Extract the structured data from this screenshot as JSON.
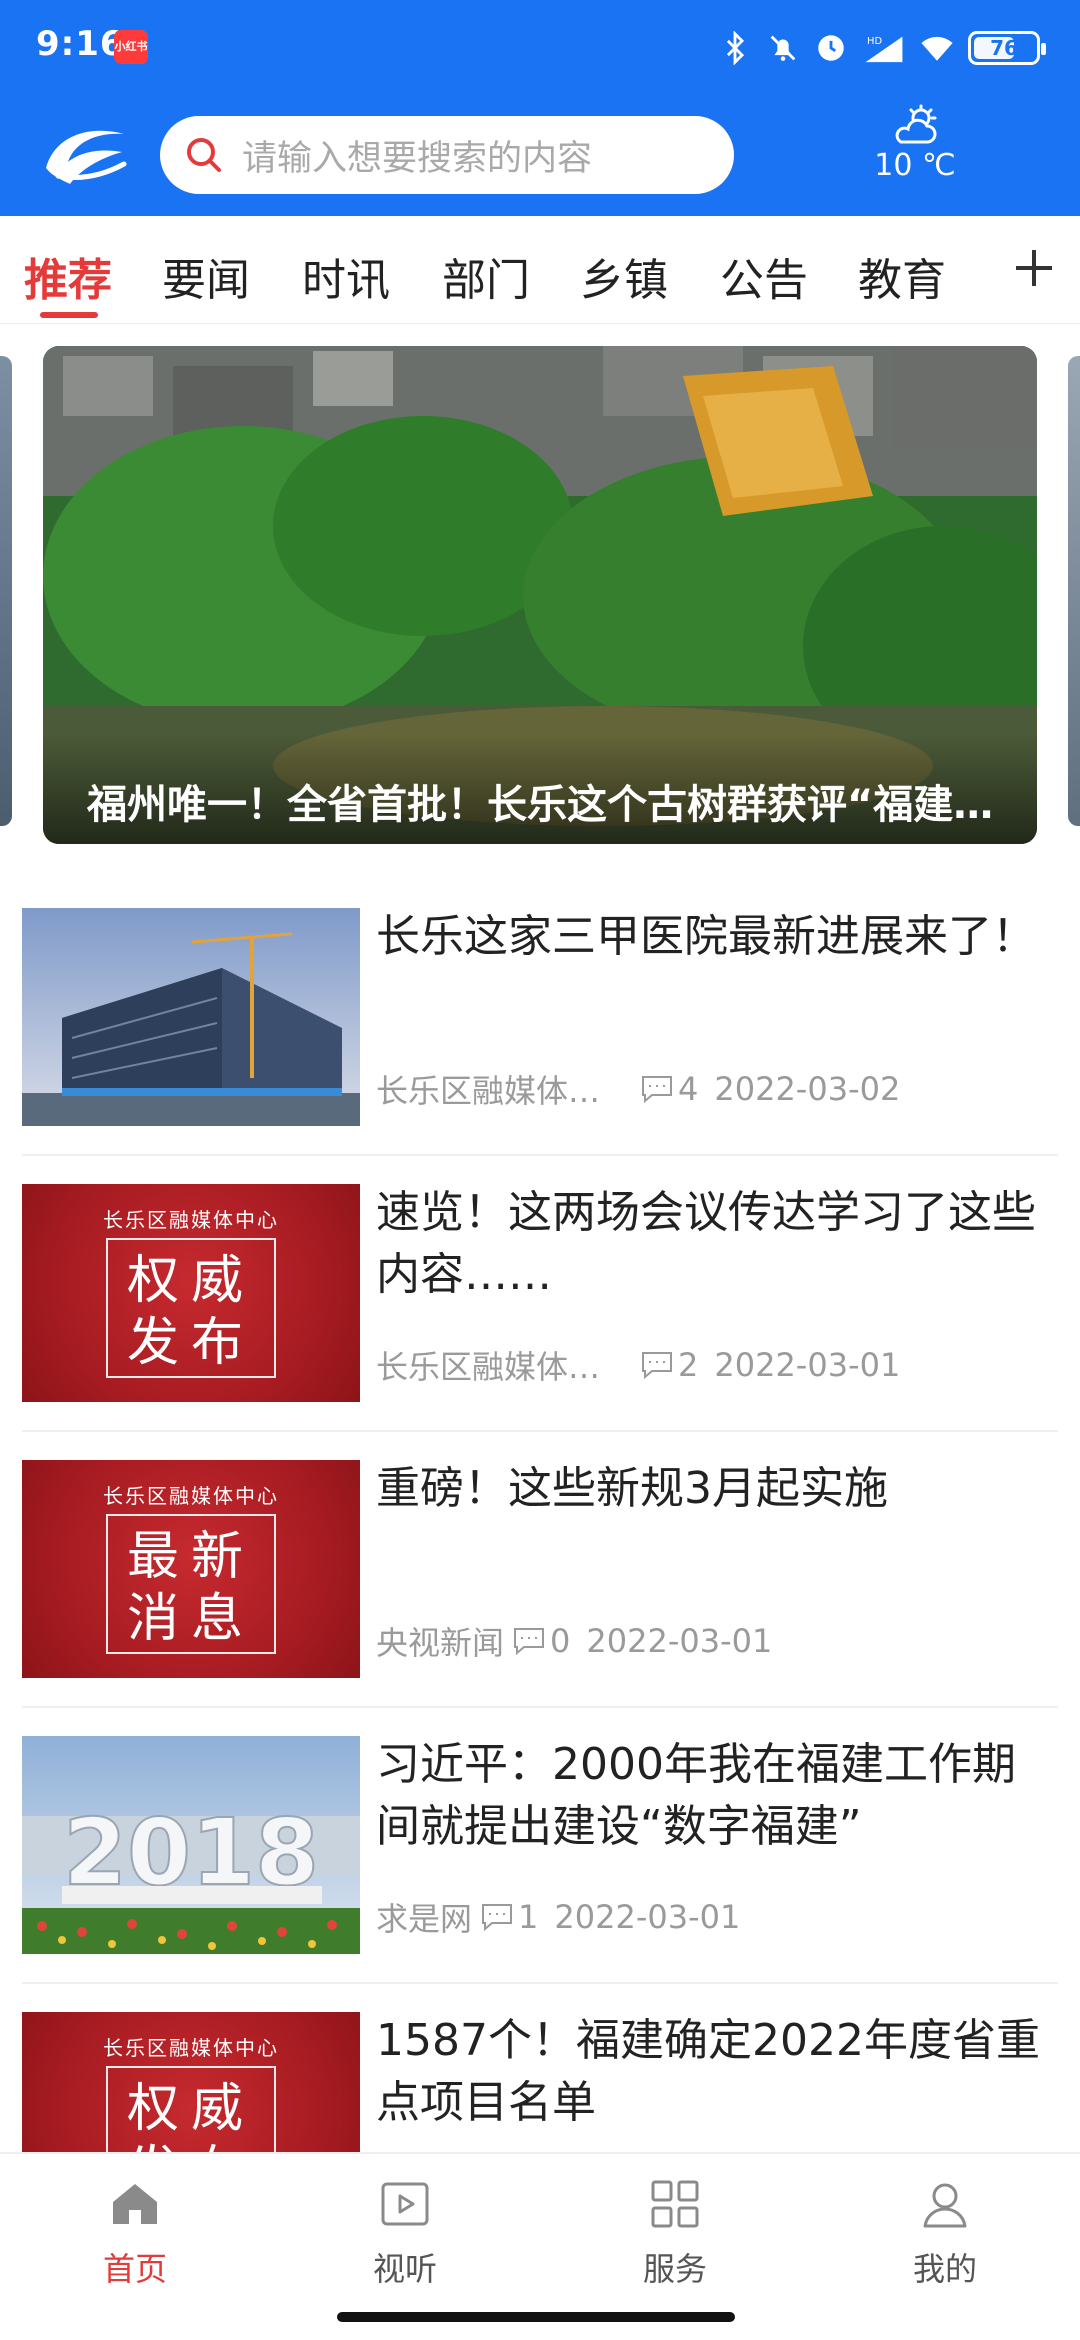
{
  "status_bar": {
    "time": "9:16",
    "app_badge": "小红书",
    "battery": "76",
    "icons": [
      "bluetooth-icon",
      "mute-icon",
      "alarm-icon",
      "signal-icon",
      "wifi-icon",
      "battery-icon"
    ]
  },
  "header": {
    "search_placeholder": "请输入想要搜索的内容",
    "weather": {
      "temp": "10 ℃",
      "icon": "cloudy-sun-icon"
    },
    "colors": {
      "primary": "#1a73f2",
      "accent": "#e53a3a"
    }
  },
  "tabs": {
    "items": [
      {
        "label": "推荐"
      },
      {
        "label": "要闻"
      },
      {
        "label": "时讯"
      },
      {
        "label": "部门"
      },
      {
        "label": "乡镇"
      },
      {
        "label": "公告"
      },
      {
        "label": "教育"
      }
    ],
    "active_index": 0
  },
  "carousel": {
    "caption": "福州唯一！全省首批！长乐这个古树群获评“福建最美古树群”"
  },
  "news": [
    {
      "title": "长乐这家三甲医院最新进展来了！",
      "source": "长乐区融媒体中心",
      "comments": "4",
      "date": "2022-03-02",
      "thumb": "construction-photo"
    },
    {
      "title": "速览！这两场会议传达学习了这些内容……",
      "source": "长乐区融媒体中心",
      "comments": "2",
      "date": "2022-03-01",
      "thumb": "red-badge",
      "badge_org": "长乐区融媒体中心",
      "badge_line1": "权威",
      "badge_line2": "发布"
    },
    {
      "title": "重磅！这些新规3月起实施",
      "source": "央视新闻",
      "comments": "0",
      "date": "2022-03-01",
      "thumb": "red-badge",
      "badge_org": "长乐区融媒体中心",
      "badge_line1": "最新",
      "badge_line2": "消息"
    },
    {
      "title": "习近平：2000年我在福建工作期间就提出建设“数字福建”",
      "source": "求是网",
      "comments": "1",
      "date": "2022-03-01",
      "thumb": "summit-photo",
      "photo_text": "2018"
    },
    {
      "title": "1587个！福建确定2022年度省重点项目名单",
      "source": "",
      "comments": "",
      "date": "",
      "thumb": "red-badge",
      "badge_org": "长乐区融媒体中心",
      "badge_line1": "权威",
      "badge_line2": "发布"
    }
  ],
  "bottom_nav": {
    "items": [
      {
        "label": "首页",
        "icon": "home-icon"
      },
      {
        "label": "视听",
        "icon": "play-icon"
      },
      {
        "label": "服务",
        "icon": "grid-icon"
      },
      {
        "label": "我的",
        "icon": "user-icon"
      }
    ],
    "active_index": 0
  }
}
